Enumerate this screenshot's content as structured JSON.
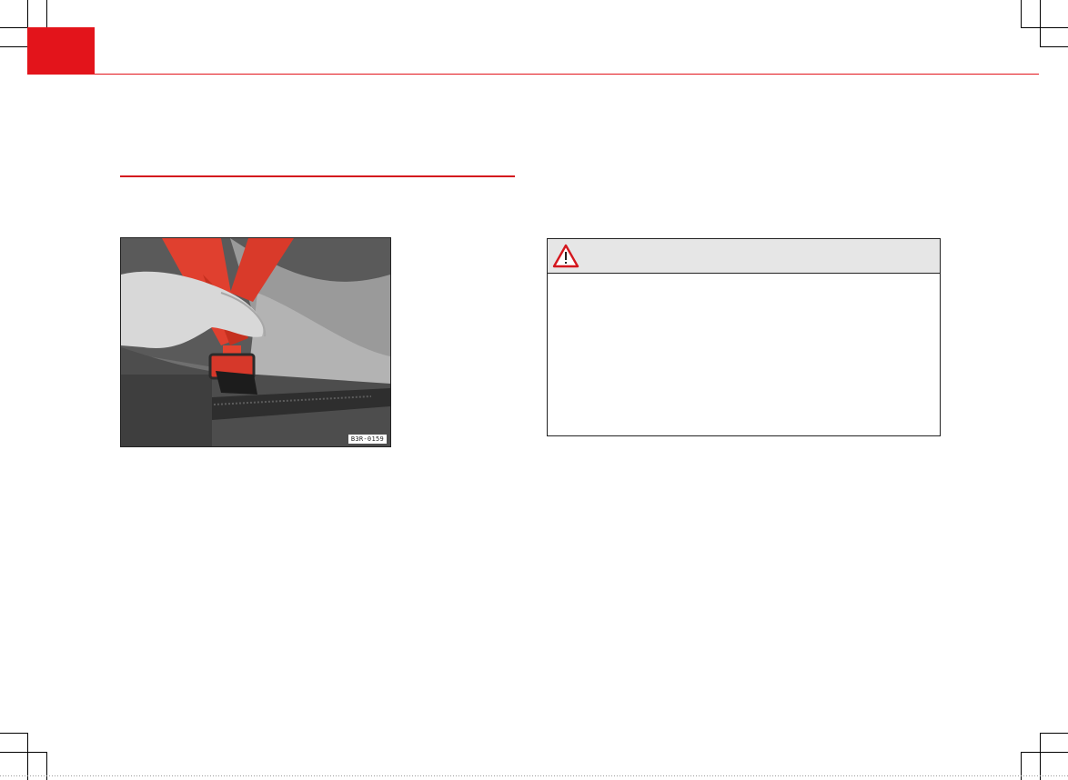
{
  "page": {
    "accent_color": "#e3141b"
  },
  "figure": {
    "label": "B3R-0159",
    "icon": "seatbelt-buckle-photo"
  },
  "warning": {
    "icon": "warning-triangle-icon"
  }
}
